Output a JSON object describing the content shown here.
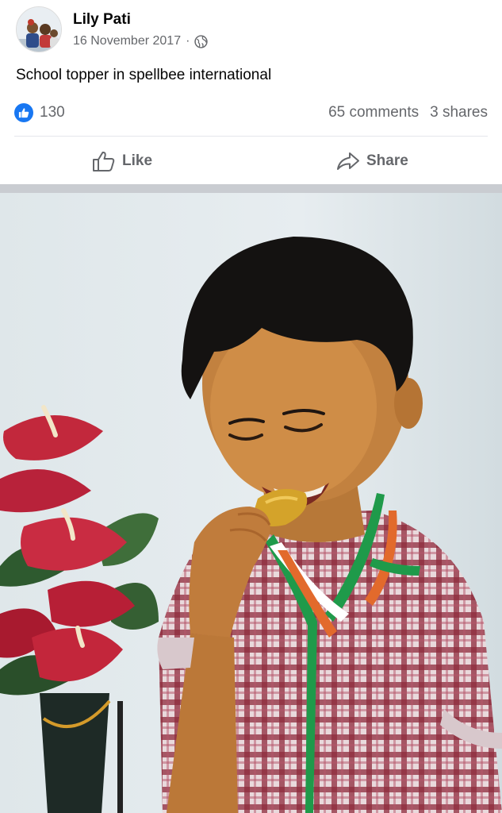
{
  "post": {
    "author": "Lily Pati",
    "date": "16 November 2017",
    "separator": "·",
    "audience_icon": "globe-icon",
    "text": "School topper in spellbee international",
    "reactions": {
      "icon": "thumbs-up-icon",
      "count": "130"
    },
    "comments": "65 comments",
    "shares": "3 shares"
  },
  "actions": {
    "like_label": "Like",
    "share_label": "Share"
  },
  "colors": {
    "brand_blue": "#1877f2",
    "secondary_text": "#65676b",
    "divider": "#e4e6eb"
  }
}
